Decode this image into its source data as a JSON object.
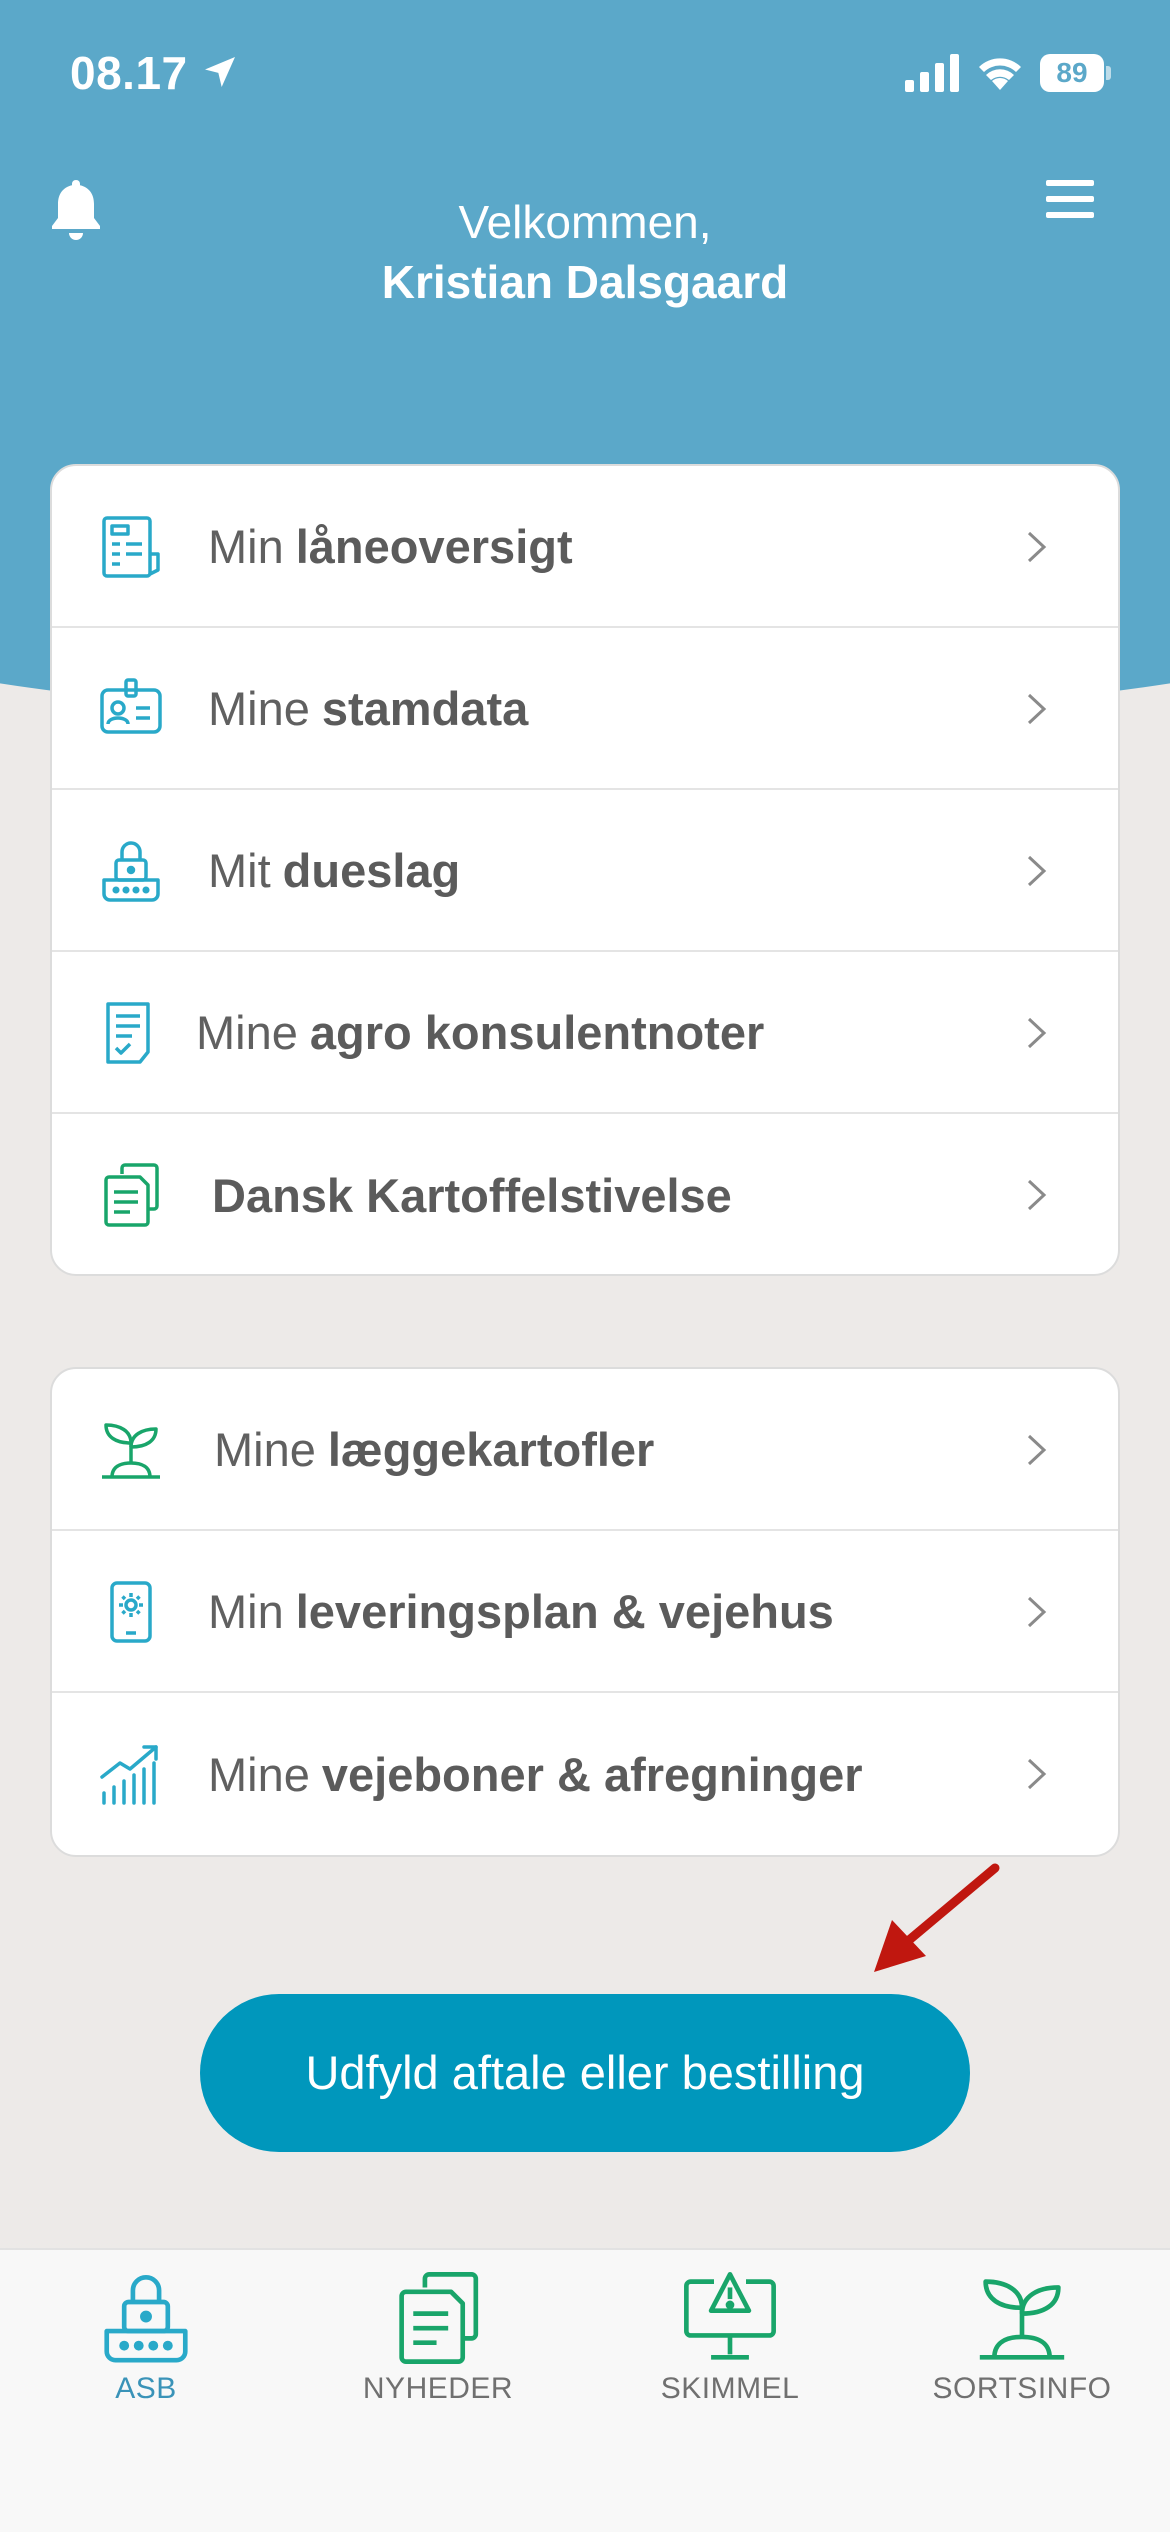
{
  "status_bar": {
    "time": "08.17",
    "battery": "89"
  },
  "header": {
    "greeting": "Velkommen,",
    "user_name": "Kristian Dalsgaard"
  },
  "menu_group_1": [
    {
      "prefix": "Min",
      "bold": "låneoversigt",
      "icon": "document-ledger-icon"
    },
    {
      "prefix": "Mine",
      "bold": "stamdata",
      "icon": "id-card-icon"
    },
    {
      "prefix": "Mit",
      "bold": "dueslag",
      "icon": "mailbox-lock-icon"
    },
    {
      "prefix": "Mine",
      "bold": "agro konsulentnoter",
      "icon": "checklist-note-icon"
    },
    {
      "prefix": "",
      "bold": "Dansk Kartoffelstivelse",
      "icon": "documents-icon"
    }
  ],
  "menu_group_2": [
    {
      "prefix": "Mine",
      "bold": "læggekartofler",
      "icon": "sprout-icon"
    },
    {
      "prefix": "Min",
      "bold": "leveringsplan & vejehus",
      "icon": "phone-settings-icon"
    },
    {
      "prefix": "Mine",
      "bold": "vejeboner & afregninger",
      "icon": "growth-chart-icon"
    }
  ],
  "cta_button": {
    "label": "Udfyld aftale eller bestilling"
  },
  "tab_bar": [
    {
      "label": "ASB",
      "icon": "mailbox-lock-icon",
      "active": true
    },
    {
      "label": "NYHEDER",
      "icon": "documents-icon",
      "active": false
    },
    {
      "label": "SKIMMEL",
      "icon": "monitor-warning-icon",
      "active": false
    },
    {
      "label": "SORTSINFO",
      "icon": "sprout-icon",
      "active": false
    }
  ],
  "colors": {
    "header": "#5ba8c9",
    "background": "#edeae8",
    "cta": "#0097bc",
    "icon_blue": "#29a9c9",
    "icon_green": "#19a56a",
    "arrow": "#c0170f"
  }
}
